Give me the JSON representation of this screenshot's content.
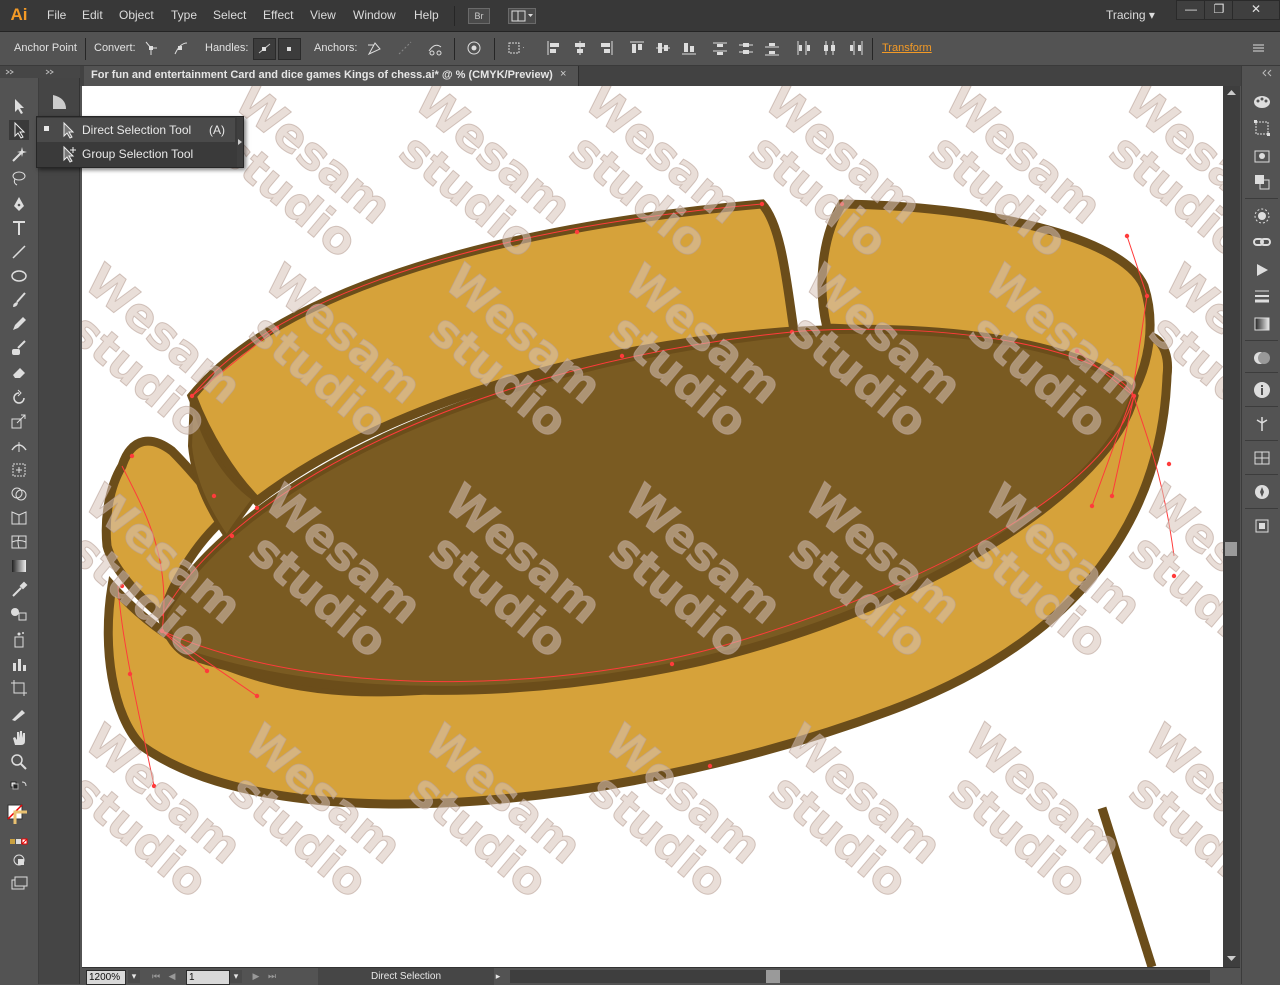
{
  "app": {
    "logo": "Ai",
    "workspace": "Tracing"
  },
  "menu": [
    "File",
    "Edit",
    "Object",
    "Type",
    "Select",
    "Effect",
    "View",
    "Window",
    "Help"
  ],
  "menu_extra": {
    "bridge_label": "Br"
  },
  "window_buttons": {
    "minimize": "—",
    "restore": "❐",
    "close": "✕"
  },
  "control_bar": {
    "tool_label": "Anchor Point",
    "convert_label": "Convert:",
    "handles_label": "Handles:",
    "anchors_label": "Anchors:",
    "transform_link": "Transform"
  },
  "document": {
    "tab_title": "For fun and entertainment Card and dice games Kings of chess.ai* @ % (CMYK/Preview)",
    "tab_close": "×"
  },
  "flyout": {
    "items": [
      {
        "label": "Direct Selection Tool",
        "shortcut": "(A)",
        "selected": true
      },
      {
        "label": "Group Selection Tool",
        "shortcut": "",
        "selected": false
      }
    ]
  },
  "status_bar": {
    "zoom": "1200%",
    "artboard": "1",
    "current_tool": "Direct Selection"
  },
  "watermark": {
    "line1": "Wesam",
    "line2": "studio"
  },
  "colors": {
    "accent": "#f39a26",
    "bowl_fill": "#d6a23a",
    "bowl_inner": "#7a5b22",
    "bowl_stroke": "#6b4d1a",
    "path_selection": "#ff3b3b",
    "watermark": "#e0cfc6"
  }
}
